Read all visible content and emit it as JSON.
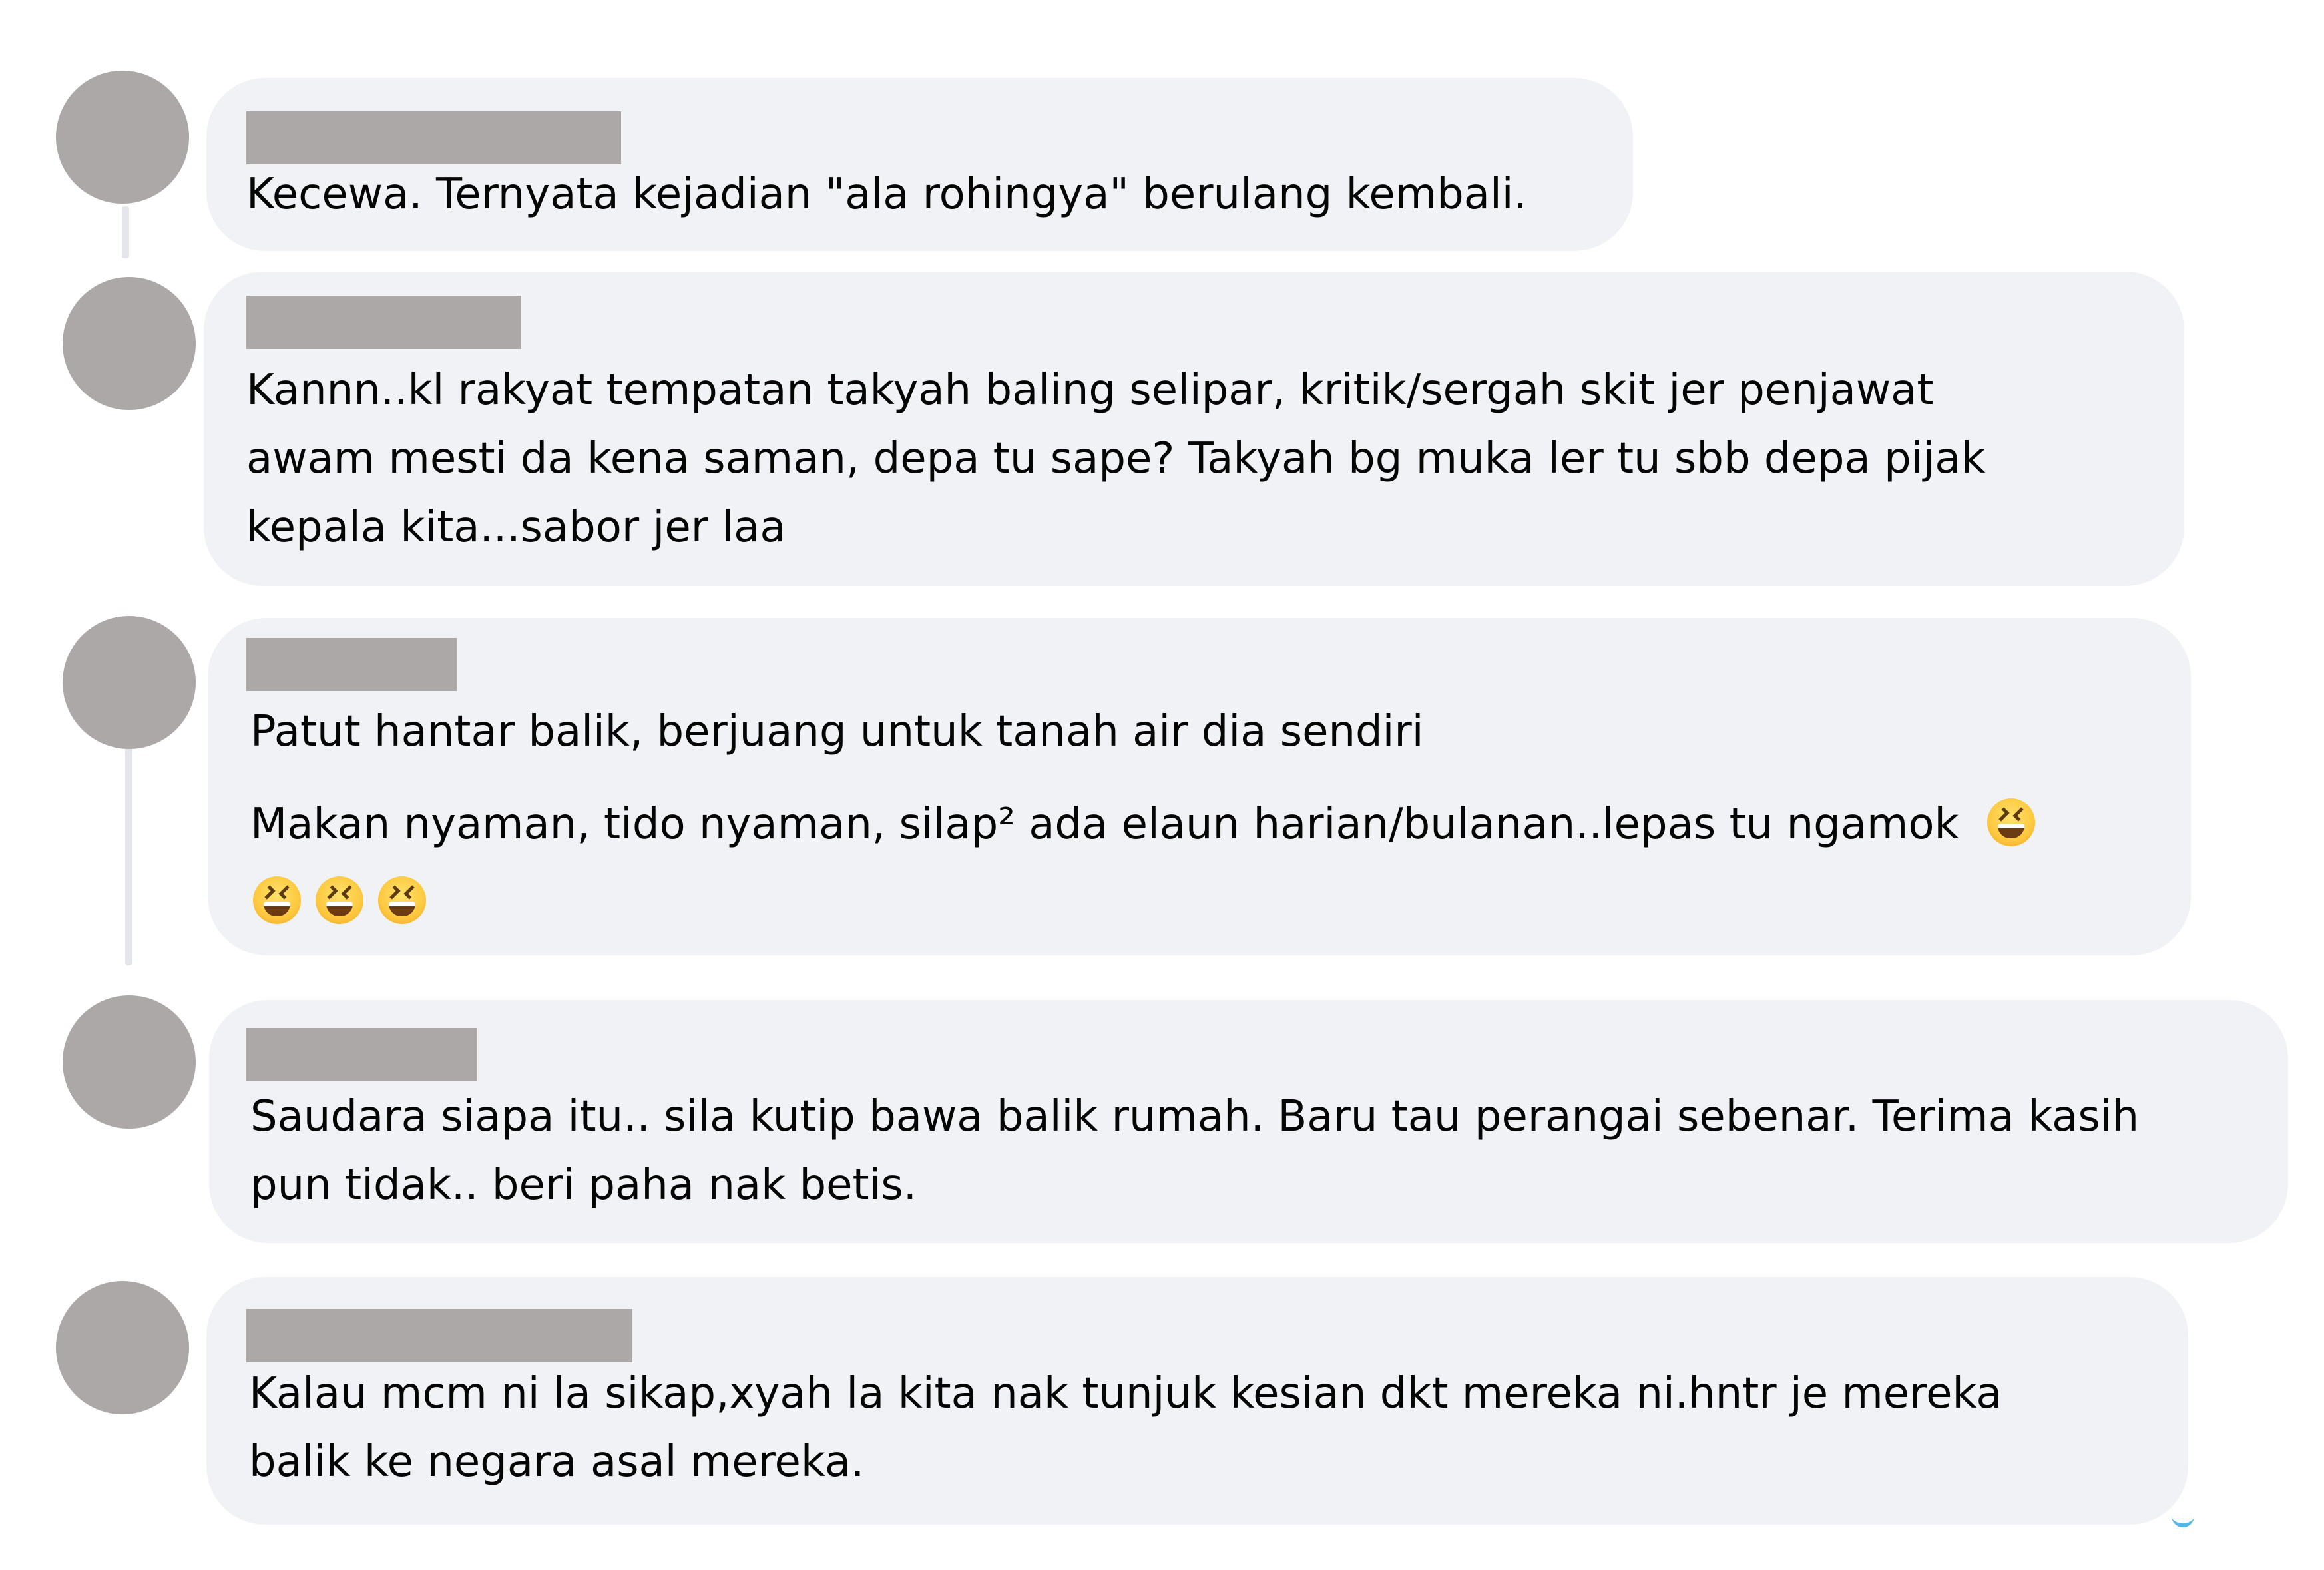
{
  "comments": [
    {
      "text": "Kecewa. Ternyata kejadian \"ala rohingya\" berulang kembali."
    },
    {
      "text": "Kannn..kl rakyat tempatan takyah baling selipar, kritik/sergah skit jer penjawat\nawam mesti da kena saman, depa tu sape? Takyah bg muka ler tu sbb depa pijak\nkepala kita...sabor jer laa"
    },
    {
      "text_line1": "Patut hantar balik, berjuang untuk tanah air dia sendiri",
      "text_line2": "Makan nyaman, tido nyaman, silap² ada elaun harian/bulanan..lepas tu ngamok",
      "emoji": [
        "grinning-squinting-face",
        "grinning-squinting-face",
        "grinning-squinting-face",
        "grinning-squinting-face"
      ]
    },
    {
      "text": "Saudara siapa itu.. sila kutip bawa balik rumah. Baru tau perangai sebenar. Terima kasih\npun tidak.. beri paha nak betis."
    },
    {
      "text": "Kalau mcm ni la sikap,xyah la kita nak tunjuk kesian dkt mereka ni.hntr je mereka\nbalik ke negara asal mereka."
    }
  ],
  "colors": {
    "bubble": "#f0f2f5",
    "redaction": "#aca8a8",
    "text": "#050505",
    "thread_line": "#e4e6eb"
  }
}
